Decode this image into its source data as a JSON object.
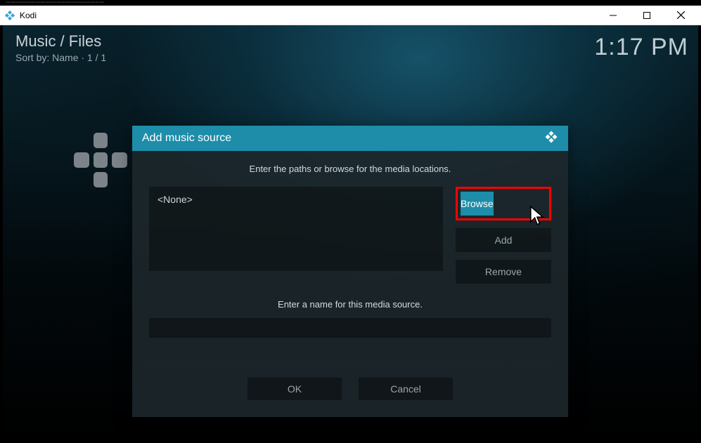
{
  "window": {
    "title": "Kodi",
    "caption_artifact": "····························································"
  },
  "header": {
    "breadcrumb": "Music / Files",
    "sort_line": "Sort by: Name  ·  1 / 1",
    "clock": "1:17 PM"
  },
  "dialog": {
    "title": "Add music source",
    "instruction_paths": "Enter the paths or browse for the media locations.",
    "path_items": [
      "<None>"
    ],
    "buttons": {
      "browse": "Browse",
      "add": "Add",
      "remove": "Remove"
    },
    "instruction_name": "Enter a name for this media source.",
    "name_value": "",
    "ok": "OK",
    "cancel": "Cancel"
  },
  "icons": {
    "kodi": "kodi-logo-icon",
    "plus": "plus-icon"
  },
  "colors": {
    "accent": "#1d8da9",
    "highlight_border": "#ff0000"
  }
}
